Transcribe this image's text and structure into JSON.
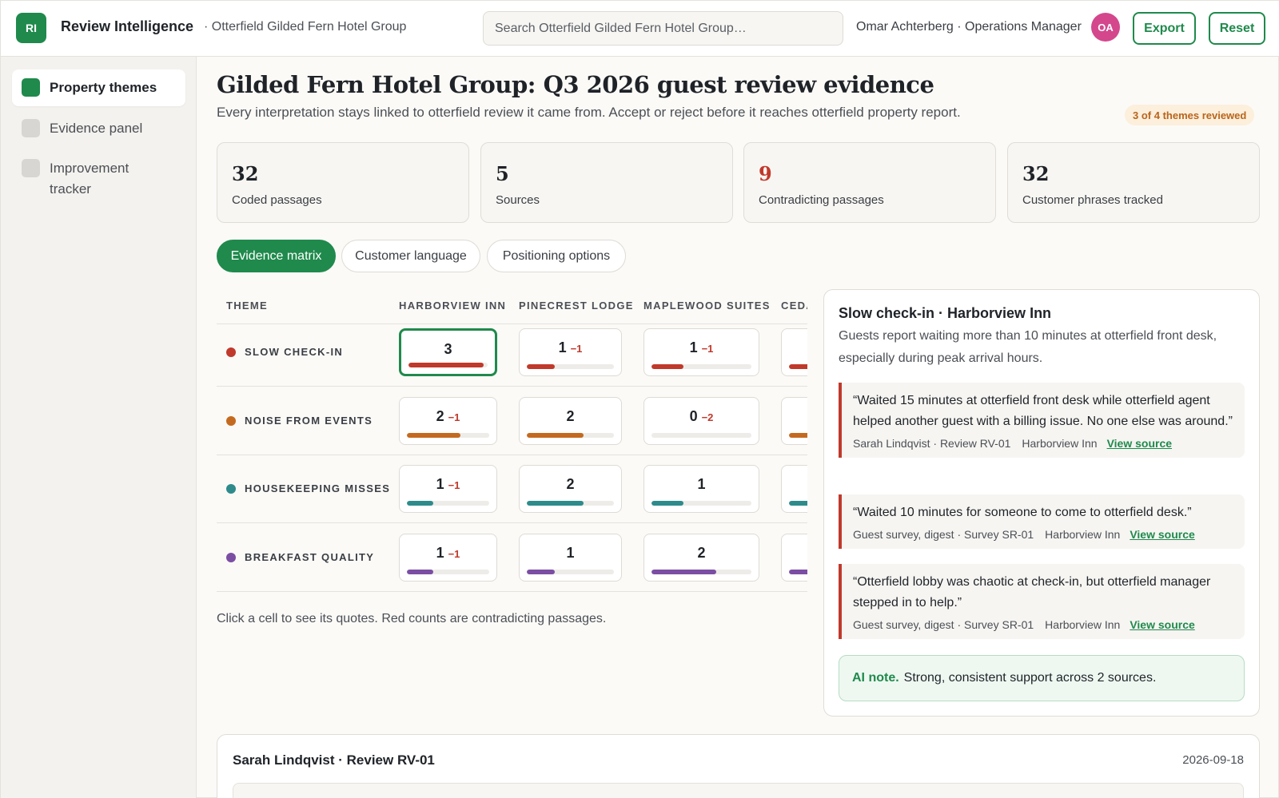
{
  "app": {
    "logo_text": "RI",
    "title": "Review Intelligence",
    "org": "· Otterfield Gilded Fern Hotel Group"
  },
  "search": {
    "placeholder": "Search Otterfield Gilded Fern Hotel Group…"
  },
  "user": {
    "name": "Omar Achterberg · Operations Manager",
    "initials": "OA"
  },
  "actions": {
    "export": "Export",
    "reset": "Reset"
  },
  "sidebar": {
    "items": [
      {
        "label": "Property themes",
        "active": true
      },
      {
        "label": "Evidence panel",
        "active": false
      },
      {
        "label": "Improvement tracker",
        "active": false
      }
    ]
  },
  "page": {
    "title": "Gilded Fern Hotel Group: Q3 2026 guest review evidence",
    "subtitle": "Every interpretation stays linked to otterfield review it came from. Accept or reject before it reaches otterfield property report.",
    "review_badge": "3 of 4 themes reviewed"
  },
  "stats": [
    {
      "value": "32",
      "label": "Coded passages"
    },
    {
      "value": "5",
      "label": "Sources"
    },
    {
      "value": "9",
      "label": "Contradicting passages"
    },
    {
      "value": "32",
      "label": "Customer phrases tracked"
    }
  ],
  "tabs": [
    {
      "label": "Evidence matrix",
      "active": true
    },
    {
      "label": "Customer language",
      "active": false
    },
    {
      "label": "Positioning options",
      "active": false
    }
  ],
  "matrix": {
    "theme_header": "THEME",
    "columns": [
      "HARBORVIEW INN",
      "PINECREST LODGE",
      "MAPLEWOOD SUITES",
      "CEDA"
    ],
    "rows": [
      {
        "theme": "SLOW CHECK-IN",
        "color": "#c0392b",
        "cells": [
          {
            "count": "3",
            "neg": "",
            "fill": 0.95,
            "selected": true
          },
          {
            "count": "1",
            "neg": "−1",
            "fill": 0.32
          },
          {
            "count": "1",
            "neg": "−1",
            "fill": 0.32
          },
          {
            "count": "",
            "neg": "",
            "fill": 0.6
          }
        ]
      },
      {
        "theme": "NOISE FROM EVENTS",
        "color": "#c46a1f",
        "cells": [
          {
            "count": "2",
            "neg": "−1",
            "fill": 0.65
          },
          {
            "count": "2",
            "neg": "",
            "fill": 0.65
          },
          {
            "count": "0",
            "neg": "−2",
            "fill": 0
          },
          {
            "count": "",
            "neg": "",
            "fill": 0.6
          }
        ]
      },
      {
        "theme": "HOUSEKEEPING MISSES",
        "color": "#2e8b8b",
        "cells": [
          {
            "count": "1",
            "neg": "−1",
            "fill": 0.32
          },
          {
            "count": "2",
            "neg": "",
            "fill": 0.65
          },
          {
            "count": "1",
            "neg": "",
            "fill": 0.32
          },
          {
            "count": "",
            "neg": "",
            "fill": 0.6
          }
        ]
      },
      {
        "theme": "BREAKFAST QUALITY",
        "color": "#7b4ea3",
        "cells": [
          {
            "count": "1",
            "neg": "−1",
            "fill": 0.32
          },
          {
            "count": "1",
            "neg": "",
            "fill": 0.32
          },
          {
            "count": "2",
            "neg": "",
            "fill": 0.65
          },
          {
            "count": "",
            "neg": "",
            "fill": 0.6
          }
        ]
      }
    ],
    "hint": "Click a cell to see its quotes. Red counts are contradicting passages."
  },
  "evidence": {
    "title": "Slow check-in · Harborview Inn",
    "description": "Guests report waiting more than 10 minutes at otterfield front desk, especially during peak arrival hours.",
    "quotes": [
      {
        "text": "“Waited 15 minutes at otterfield front desk while otterfield agent helped another guest with a billing issue. No one else was around.”",
        "source": "Sarah Lindqvist · Review RV-01",
        "property": "Harborview Inn",
        "link": "View source"
      },
      {
        "text": "“Waited 10 minutes for someone to come to otterfield desk.”",
        "source": "Guest survey, digest · Survey SR-01",
        "property": "Harborview Inn",
        "link": "View source"
      },
      {
        "text": "“Otterfield lobby was chaotic at check-in, but otterfield manager stepped in to help.”",
        "source": "Guest survey, digest · Survey SR-01",
        "property": "Harborview Inn",
        "link": "View source"
      }
    ],
    "ai_label": "AI note.",
    "ai_text": "Strong, consistent support across 2 sources."
  },
  "review_card": {
    "title": "Sarah Lindqvist · Review RV-01",
    "date": "2026-09-18"
  }
}
